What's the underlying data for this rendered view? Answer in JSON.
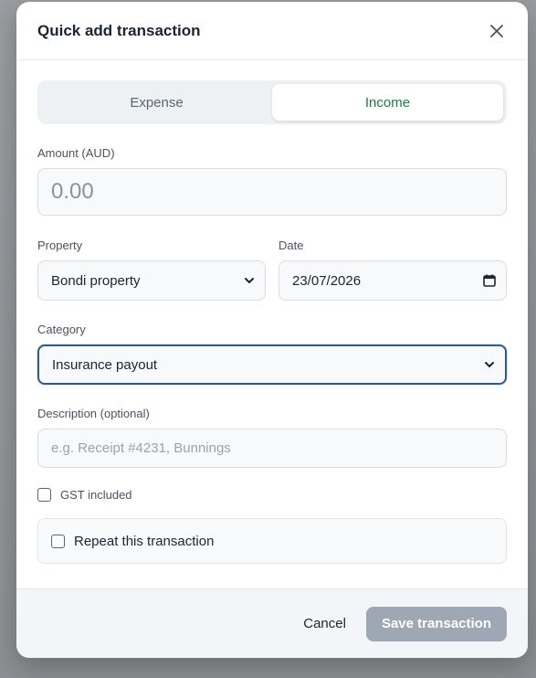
{
  "modal": {
    "title": "Quick add transaction"
  },
  "type_toggle": {
    "options": [
      "Expense",
      "Income"
    ],
    "selected": "Income"
  },
  "amount": {
    "label": "Amount (AUD)",
    "placeholder": "0.00"
  },
  "property": {
    "label": "Property",
    "value": "Bondi property"
  },
  "date": {
    "label": "Date",
    "value": "23/07/2026"
  },
  "category": {
    "label": "Category",
    "value": "Insurance payout"
  },
  "description": {
    "label": "Description (optional)",
    "placeholder": "e.g. Receipt #4231, Bunnings"
  },
  "gst": {
    "label": "GST included",
    "checked": false
  },
  "repeat": {
    "label": "Repeat this transaction",
    "checked": false
  },
  "footer": {
    "cancel_label": "Cancel",
    "save_label": "Save transaction"
  },
  "colors": {
    "income_accent": "#1f7a3f",
    "focus_border": "#2e5d8a",
    "save_disabled": "#9ea8b5"
  }
}
